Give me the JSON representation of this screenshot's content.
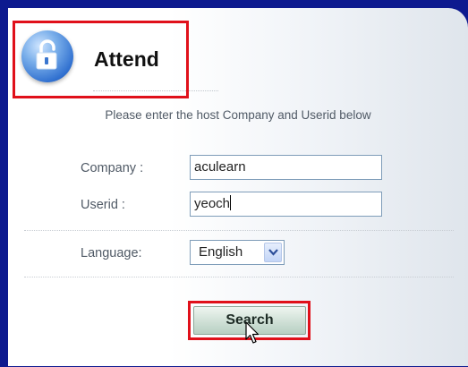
{
  "header": {
    "title": "Attend",
    "logo_icon": "padlock-icon"
  },
  "instruction": "Please enter the host Company and Userid below",
  "form": {
    "company_label": "Company :",
    "company_value": "aculearn",
    "userid_label": "Userid :",
    "userid_value": "yeoch",
    "language_label": "Language:",
    "language_selected": "English"
  },
  "actions": {
    "search_label": "Search"
  },
  "colors": {
    "window_border": "#0d1a8f",
    "highlight": "#e0101a",
    "logo_blue": "#2f6fcf"
  }
}
